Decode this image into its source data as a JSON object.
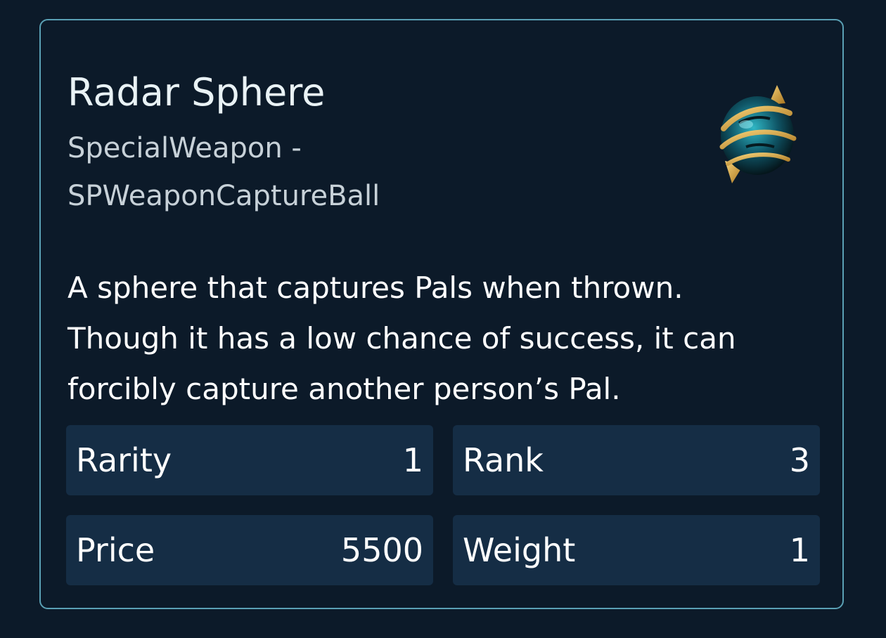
{
  "item": {
    "name": "Radar Sphere",
    "category_lines": [
      "SpecialWeapon -",
      "SPWeaponCaptureBall"
    ],
    "icon": "capture-sphere-icon",
    "description_lines": [
      "A sphere that captures Pals when thrown.",
      "Though it has a low chance of success, it can",
      "forcibly capture another person’s Pal."
    ]
  },
  "stats": {
    "rarity": {
      "label": "Rarity",
      "value": "1"
    },
    "rank": {
      "label": "Rank",
      "value": "3"
    },
    "price": {
      "label": "Price",
      "value": "5500"
    },
    "weight": {
      "label": "Weight",
      "value": "1"
    }
  },
  "colors": {
    "background": "#0c1a29",
    "card_border": "#5aa0b4",
    "stat_background": "#152d45",
    "title_text": "#e9f2f5",
    "subtitle_text": "#c7d1d8",
    "body_text": "#ffffff"
  }
}
